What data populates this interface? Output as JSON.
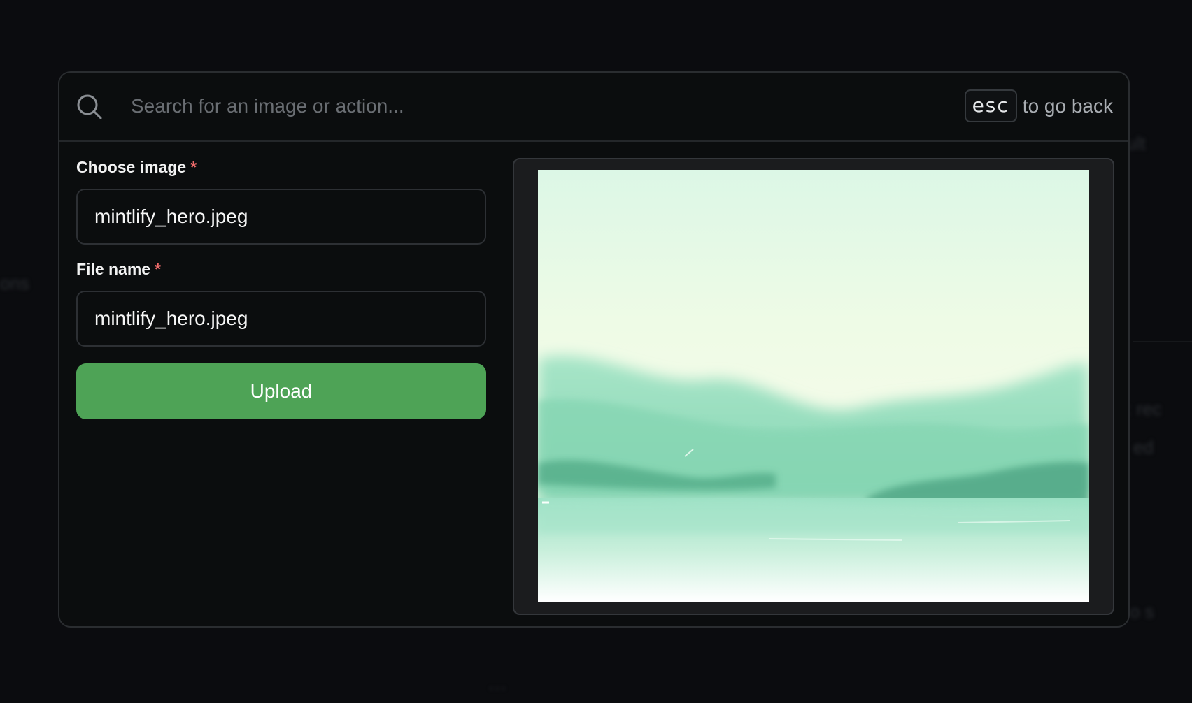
{
  "search": {
    "placeholder": "Search for an image or action..."
  },
  "esc_hint": {
    "key": "esc",
    "text": "to go back"
  },
  "form": {
    "choose_image": {
      "label": "Choose image",
      "required_mark": "*",
      "value": "mintlify_hero.jpeg"
    },
    "file_name": {
      "label": "File name",
      "required_mark": "*",
      "value": "mintlify_hero.jpeg"
    },
    "upload_label": "Upload"
  },
  "preview": {
    "image_name": "mintlify_hero.jpeg"
  },
  "colors": {
    "background": "#0b0c0e",
    "modal_border": "#2a2d30",
    "accent_green": "#4ea356",
    "required_red": "#ef6b6b",
    "placeholder": "#6a6e73"
  },
  "icons": {
    "search": "search-icon",
    "image": "landscape-image"
  }
}
